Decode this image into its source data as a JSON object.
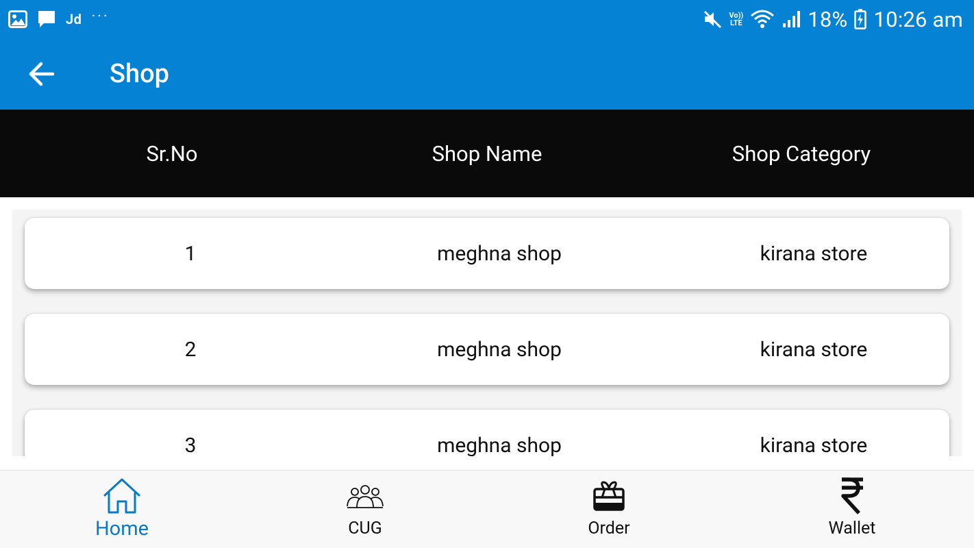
{
  "status_bar": {
    "left_text": "Jd",
    "more_glyph": "···",
    "network_label_top": "Vo))",
    "network_label_bottom": "LTE",
    "battery_percent": "18%",
    "time": "10:26 am",
    "icons": [
      "gallery-icon",
      "message-icon",
      "mute-icon",
      "wifi-icon",
      "signal-icon",
      "battery-charging-icon"
    ]
  },
  "app_bar": {
    "title": "Shop",
    "back_icon": "arrow-left-icon"
  },
  "table": {
    "headers": [
      "Sr.No",
      "Shop Name",
      "Shop Category"
    ],
    "rows": [
      {
        "sr_no": "1",
        "shop_name": "meghna shop",
        "shop_category": "kirana store"
      },
      {
        "sr_no": "2",
        "shop_name": "meghna shop",
        "shop_category": "kirana store"
      },
      {
        "sr_no": "3",
        "shop_name": "meghna shop",
        "shop_category": "kirana store"
      }
    ]
  },
  "bottom_nav": {
    "items": [
      {
        "label": "Home",
        "icon": "home-icon",
        "active": true
      },
      {
        "label": "CUG",
        "icon": "group-icon",
        "active": false
      },
      {
        "label": "Order",
        "icon": "gift-box-icon",
        "active": false
      },
      {
        "label": "Wallet",
        "icon": "rupee-icon",
        "active": false
      }
    ]
  },
  "colors": {
    "primary": "#0582d4",
    "header_bg": "#0a0a0a",
    "active_nav": "#0a7ac4",
    "card_bg": "#ffffff",
    "nav_bg": "#f8f8f8"
  }
}
